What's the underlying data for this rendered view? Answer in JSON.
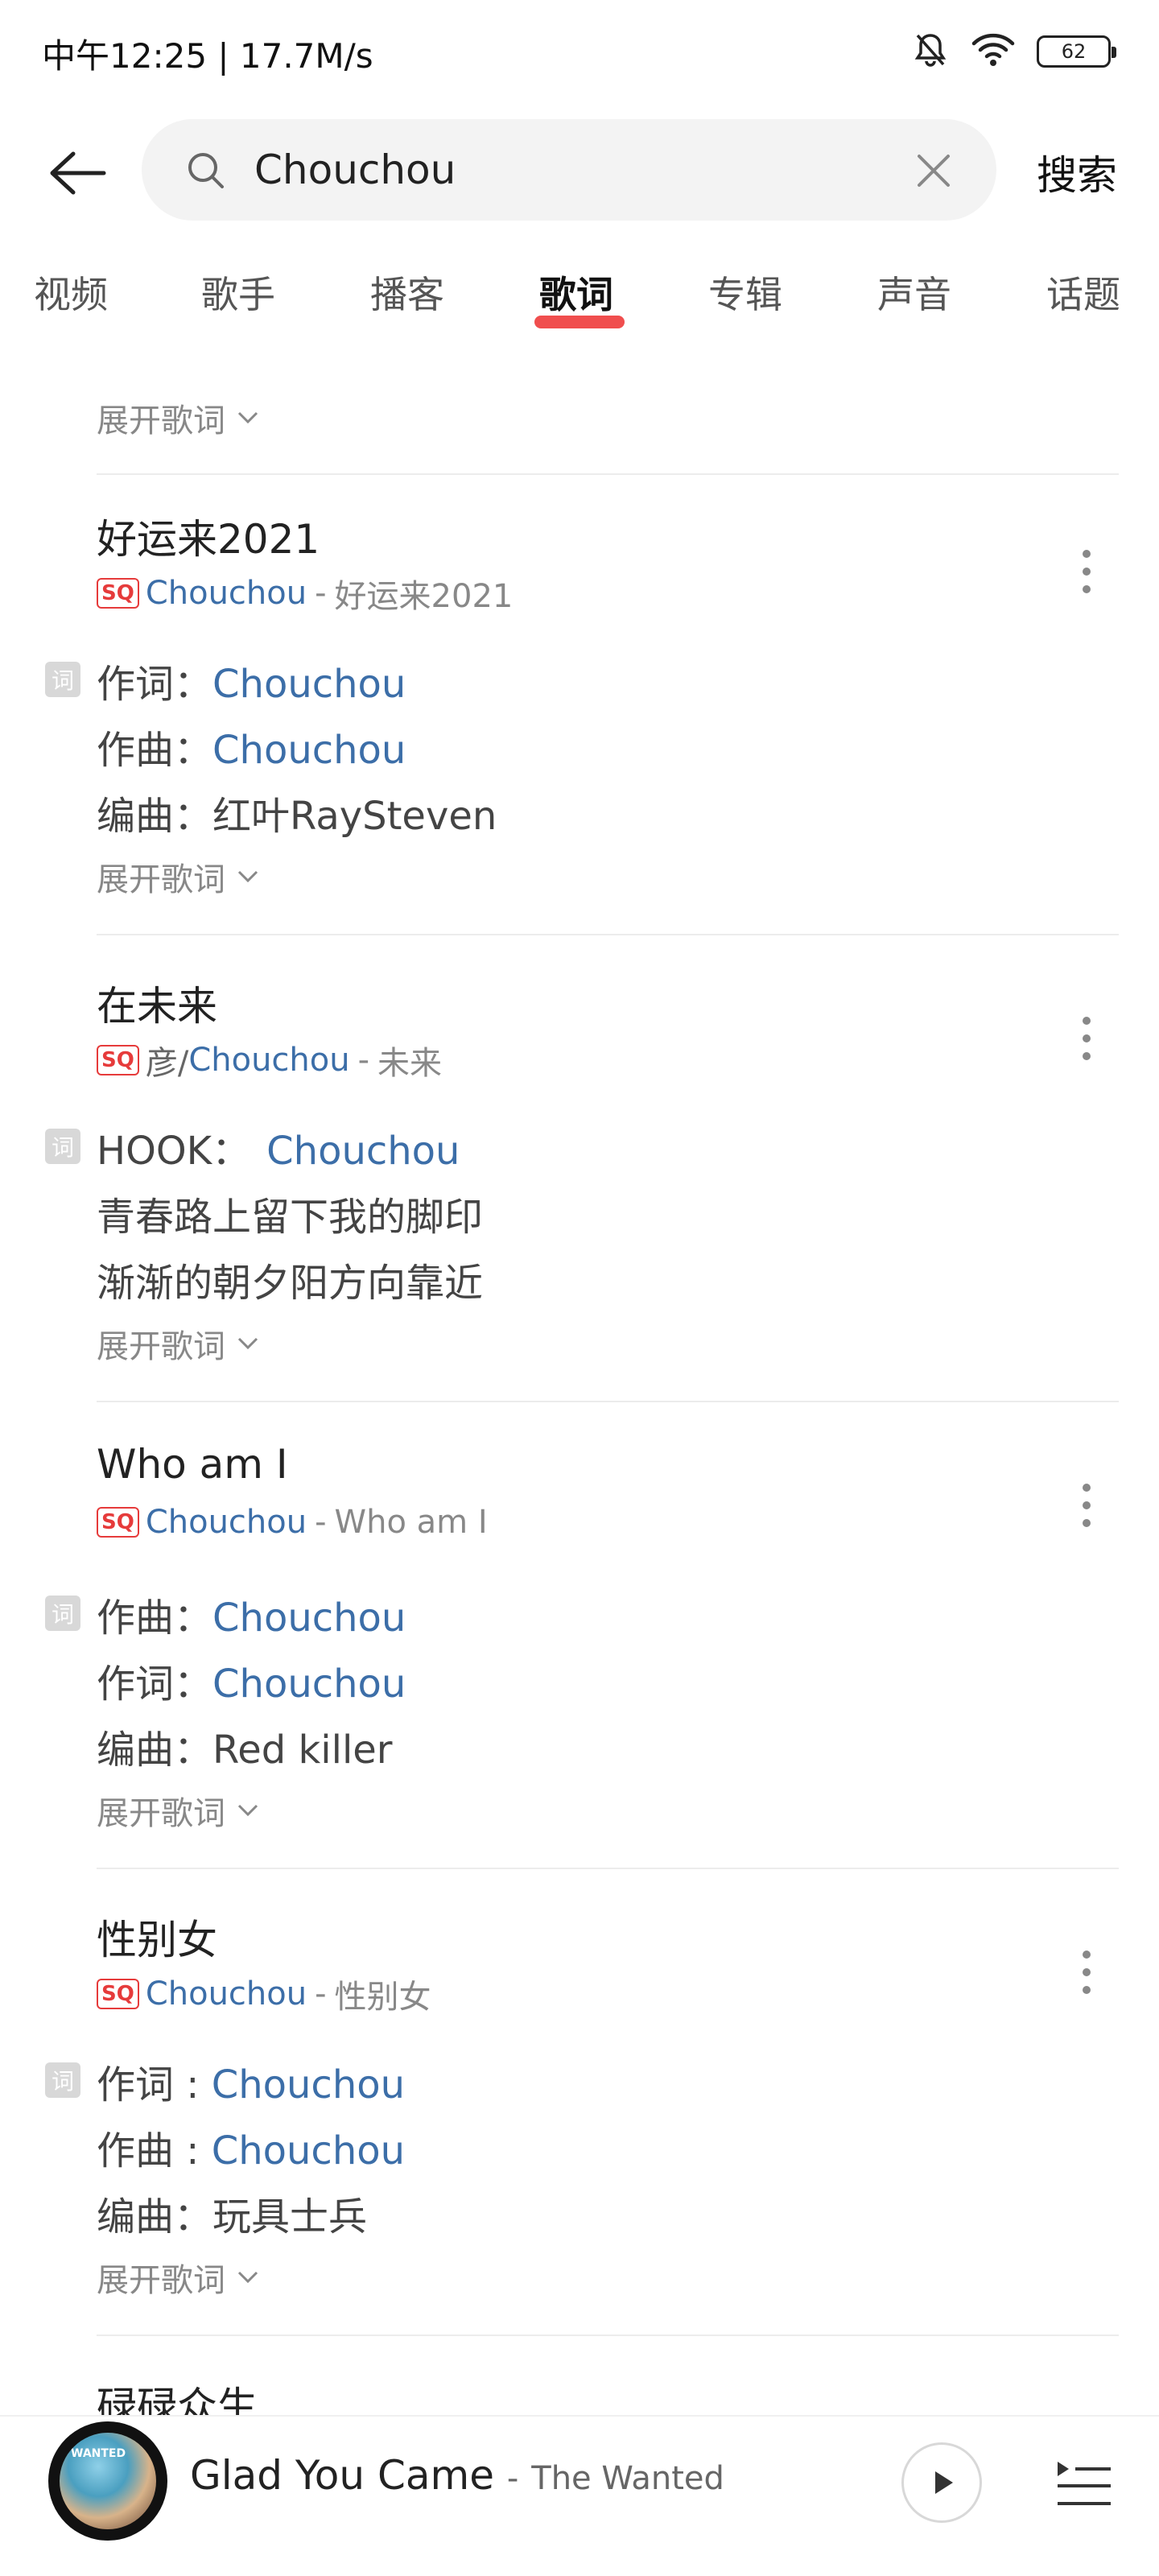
{
  "status": {
    "time": "中午12:25 | 17.7M/s",
    "battery": "62"
  },
  "search": {
    "query": "Chouchou",
    "button": "搜索"
  },
  "tabs": [
    "视频",
    "歌手",
    "播客",
    "歌词",
    "专辑",
    "声音",
    "话题"
  ],
  "active_tab": "歌词",
  "expand_label": "展开歌词",
  "sq_badge": "SQ",
  "lyric_tag": "词",
  "separator": "-",
  "songs": [
    {
      "title": "好运来2021",
      "artist_prefix": "",
      "artist": "Chouchou",
      "album": "好运来2021",
      "lines": [
        {
          "label": "作词：",
          "value": "Chouchou"
        },
        {
          "label": "作曲：",
          "value": "Chouchou"
        },
        {
          "label": "编曲：",
          "value": "红叶RaySteven"
        }
      ]
    },
    {
      "title": "在未来",
      "artist_prefix": "彦/",
      "artist": "Chouchou",
      "album": "未来",
      "lines": [
        {
          "label": "HOOK：",
          "value": "Chouchou"
        },
        {
          "label": "青春路上留下我的脚印",
          "value": ""
        },
        {
          "label": "渐渐的朝夕阳方向靠近",
          "value": ""
        }
      ]
    },
    {
      "title": "Who am I",
      "artist_prefix": "",
      "artist": "Chouchou",
      "album": "Who am I",
      "lines": [
        {
          "label": "作曲：",
          "value": "Chouchou"
        },
        {
          "label": "作词：",
          "value": "Chouchou"
        },
        {
          "label": "编曲：",
          "value": "Red killer"
        }
      ]
    },
    {
      "title": "性别女",
      "artist_prefix": "",
      "artist": "Chouchou",
      "album": "性别女",
      "lines": [
        {
          "label": "作词 : ",
          "value": "Chouchou"
        },
        {
          "label": "作曲 : ",
          "value": "Chouchou"
        },
        {
          "label": "编曲：",
          "value": "玩具士兵"
        }
      ]
    },
    {
      "title": "碌碌众生",
      "artist_prefix": "",
      "artist": "",
      "album": "",
      "lines": []
    }
  ],
  "player": {
    "title": "Glad You Came",
    "artist": "The Wanted",
    "album_art_text": "WANTED"
  },
  "colors": {
    "accent": "#ee3b3b",
    "link": "#3c6ea8"
  }
}
